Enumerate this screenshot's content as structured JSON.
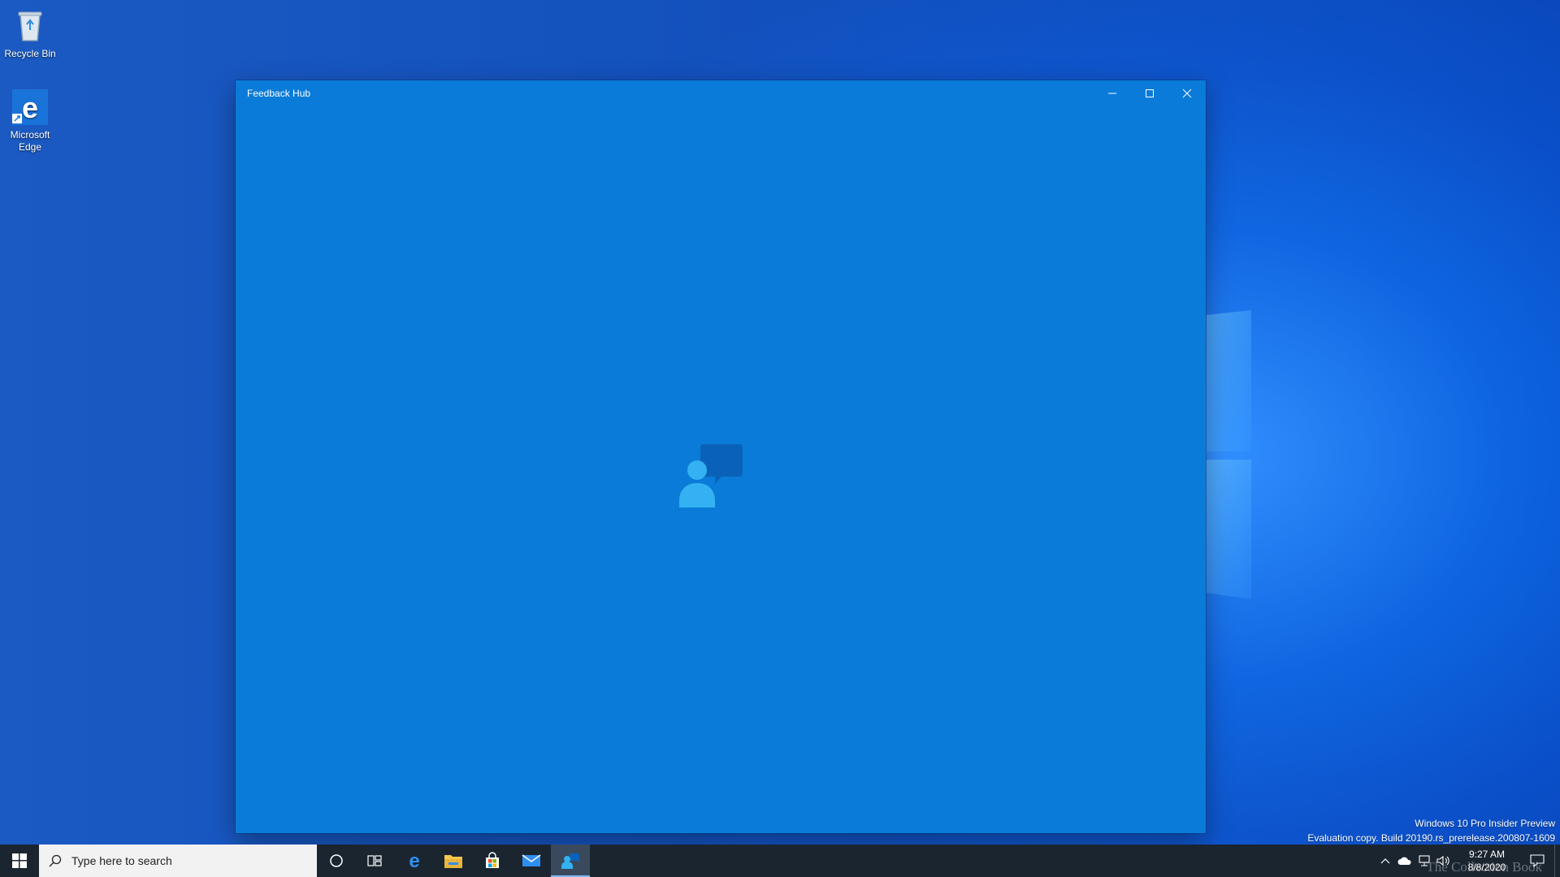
{
  "desktop": {
    "icons": [
      {
        "label": "Recycle Bin",
        "icon": "recycle-bin-icon"
      },
      {
        "label": "Microsoft Edge",
        "icon": "edge-icon"
      }
    ]
  },
  "window": {
    "title": "Feedback Hub",
    "background": "#0a7bd8",
    "splash_icon": "feedback-person-bubble-icon"
  },
  "watermark": {
    "line1": "Windows 10 Pro Insider Preview",
    "line2": "Evaluation copy. Build 20190.rs_prerelease.200807-1609"
  },
  "taskbar": {
    "search_placeholder": "Type here to search",
    "pinned": [
      {
        "name": "cortana",
        "icon": "cortana-circle-icon"
      },
      {
        "name": "task-view",
        "icon": "task-view-icon"
      },
      {
        "name": "edge",
        "icon": "edge-icon"
      },
      {
        "name": "file-explorer",
        "icon": "folder-icon"
      },
      {
        "name": "store",
        "icon": "store-bag-icon"
      },
      {
        "name": "mail",
        "icon": "mail-icon"
      },
      {
        "name": "feedback-hub",
        "icon": "feedback-hub-icon",
        "active": true
      }
    ],
    "tray": {
      "time": "9:27 AM",
      "date": "8/8/2020"
    }
  },
  "brand_overlay": "The Collection Book"
}
